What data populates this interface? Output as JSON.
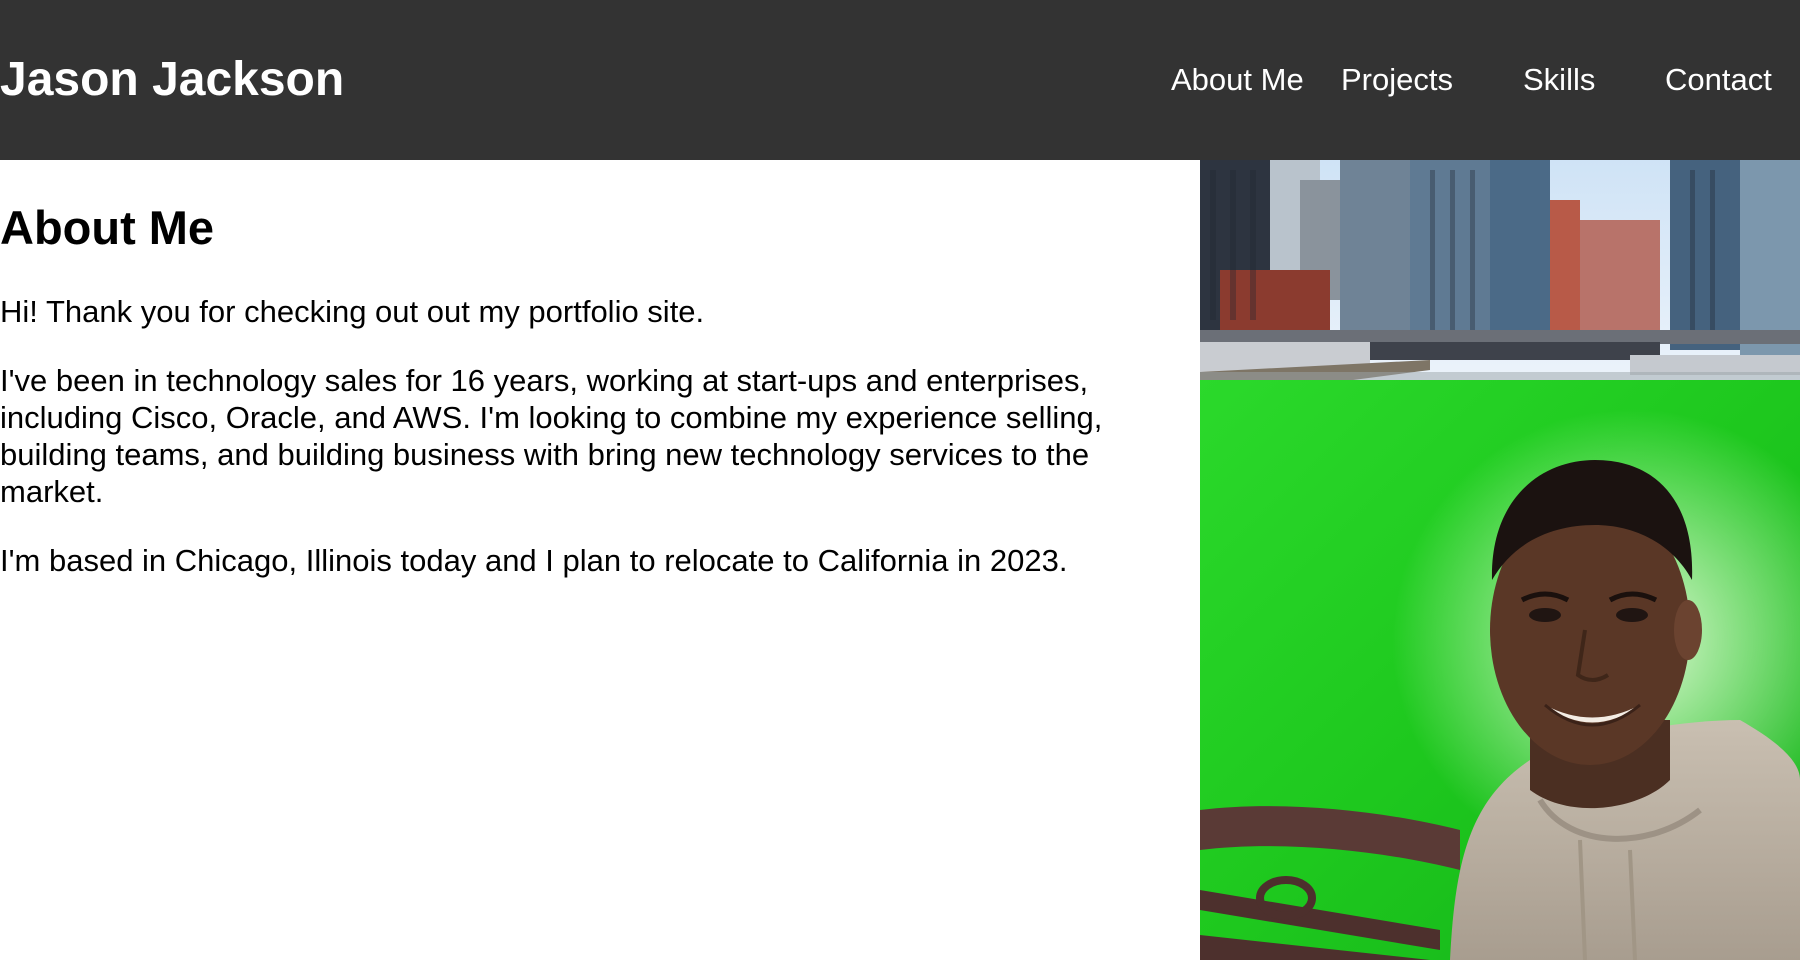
{
  "header": {
    "title": "Jason Jackson",
    "nav": [
      {
        "label": "About Me"
      },
      {
        "label": "Projects"
      },
      {
        "label": "Skills"
      },
      {
        "label": "Contact"
      }
    ],
    "background": "#333333"
  },
  "about": {
    "heading": "About Me",
    "paragraphs": [
      "Hi! Thank you for checking out out my portfolio site.",
      "I've been in technology sales for 16 years, working at start-ups and enterprises, including Cisco, Oracle, and AWS. I'm looking to combine my experience selling, building teams, and building business with bring new technology services to the market.",
      "I'm based in Chicago, Illinois today and I plan to relocate to California in 2023."
    ]
  },
  "colors": {
    "river_green": "#22d322",
    "text": "#000000"
  }
}
